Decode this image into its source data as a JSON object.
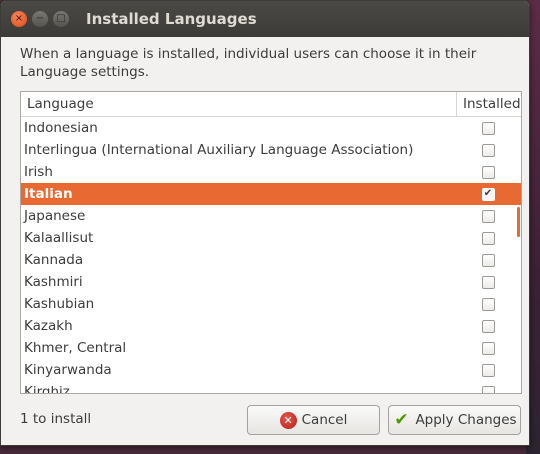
{
  "window": {
    "title": "Installed Languages",
    "buttons": {
      "close": "×",
      "minimize": "−",
      "maximize": "□"
    }
  },
  "description": "When a language is installed, individual users can choose it in their Language settings.",
  "list": {
    "headers": {
      "language": "Language",
      "installed": "Installed"
    },
    "rows": [
      {
        "name": "Indonesian",
        "installed": false,
        "selected": false
      },
      {
        "name": "Interlingua (International Auxiliary Language Association)",
        "installed": false,
        "selected": false
      },
      {
        "name": "Irish",
        "installed": false,
        "selected": false
      },
      {
        "name": "Italian",
        "installed": true,
        "selected": true
      },
      {
        "name": "Japanese",
        "installed": false,
        "selected": false
      },
      {
        "name": "Kalaallisut",
        "installed": false,
        "selected": false
      },
      {
        "name": "Kannada",
        "installed": false,
        "selected": false
      },
      {
        "name": "Kashmiri",
        "installed": false,
        "selected": false
      },
      {
        "name": "Kashubian",
        "installed": false,
        "selected": false
      },
      {
        "name": "Kazakh",
        "installed": false,
        "selected": false
      },
      {
        "name": "Khmer, Central",
        "installed": false,
        "selected": false
      },
      {
        "name": "Kinyarwanda",
        "installed": false,
        "selected": false
      },
      {
        "name": "Kirghiz",
        "installed": false,
        "selected": false
      }
    ]
  },
  "status": "1 to install",
  "actions": {
    "cancel": "Cancel",
    "apply": "Apply Changes",
    "cancel_icon": "cancel-icon",
    "apply_icon": "checkmark-icon"
  },
  "colors": {
    "accent": "#e86a32",
    "titlebar": "#3c3b37",
    "window_bg": "#f2f1f0"
  }
}
